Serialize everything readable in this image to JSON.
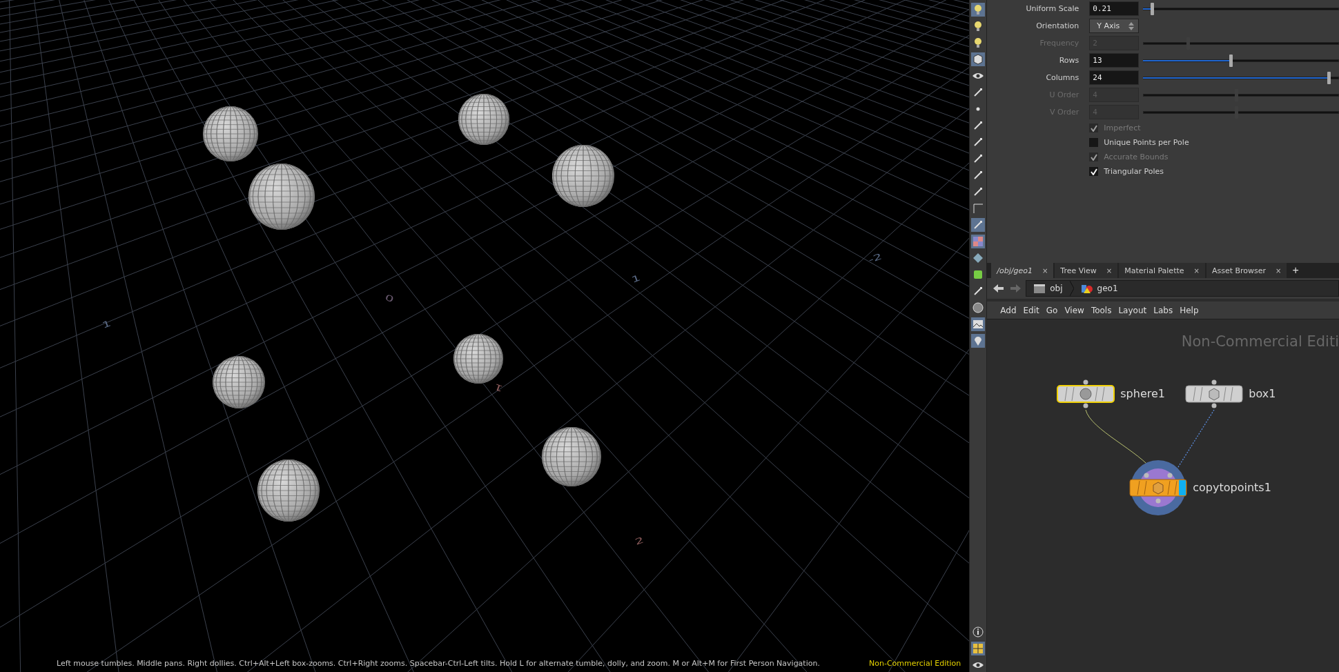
{
  "viewport": {
    "grid_labels": [
      "1",
      "0",
      "1",
      "-2",
      "1",
      "2"
    ],
    "status_hint": "Left mouse tumbles. Middle pans. Right dollies. Ctrl+Alt+Left box-zooms. Ctrl+Right zooms. Spacebar-Ctrl-Left tilts. Hold L for alternate tumble, dolly, and zoom. M or Alt+M for First Person Navigation.",
    "edition": "Non-Commercial Edition"
  },
  "parameters": [
    {
      "kind": "slider",
      "label": "Uniform Scale",
      "value": "0.21",
      "level": 0.05,
      "disabled": false
    },
    {
      "kind": "menu",
      "label": "Orientation",
      "value": "Y Axis"
    },
    {
      "kind": "slider",
      "label": "Frequency",
      "value": "2",
      "level": 0.23,
      "disabled": true
    },
    {
      "kind": "slider",
      "label": "Rows",
      "value": "13",
      "level": 0.45,
      "disabled": false
    },
    {
      "kind": "slider",
      "label": "Columns",
      "value": "24",
      "level": 0.95,
      "disabled": false
    },
    {
      "kind": "slider",
      "label": "U Order",
      "value": "4",
      "level": 0.48,
      "disabled": true
    },
    {
      "kind": "slider",
      "label": "V Order",
      "value": "4",
      "level": 0.48,
      "disabled": true
    },
    {
      "kind": "checkbox",
      "label": "Imperfect",
      "checked": true,
      "disabled": true
    },
    {
      "kind": "checkbox",
      "label": "Unique Points per Pole",
      "checked": false,
      "disabled": false
    },
    {
      "kind": "checkbox",
      "label": "Accurate Bounds",
      "checked": true,
      "disabled": true
    },
    {
      "kind": "checkbox",
      "label": "Triangular Poles",
      "checked": true,
      "disabled": false
    }
  ],
  "network": {
    "tabs": [
      {
        "label": "/obj/geo1",
        "selected": true,
        "close": "×"
      },
      {
        "label": "Tree View",
        "selected": false,
        "close": "×"
      },
      {
        "label": "Material Palette",
        "selected": false,
        "close": "×"
      },
      {
        "label": "Asset Browser",
        "selected": false,
        "close": "×"
      }
    ],
    "add_tab": "+",
    "path": [
      "obj",
      "geo1"
    ],
    "menu": [
      "Add",
      "Edit",
      "Go",
      "View",
      "Tools",
      "Layout",
      "Labs",
      "Help"
    ],
    "watermark": "Non-Commercial Editi",
    "nodes": [
      {
        "kind": "sop",
        "name": "sphere1",
        "selected": true
      },
      {
        "kind": "sop",
        "name": "box1",
        "selected": false
      },
      {
        "kind": "copy",
        "name": "copytopoints1",
        "selected": false
      }
    ]
  }
}
